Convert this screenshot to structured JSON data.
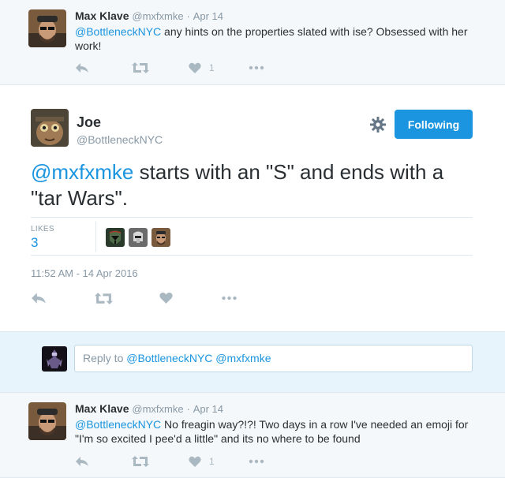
{
  "tweets": {
    "top": {
      "author_name": "Max Klave",
      "handle": "@mxfxmke",
      "separator": "·",
      "date": "Apr 14",
      "mention": "@BottleneckNYC",
      "text": " any hints on the properties slated with ise? Obsessed with her work!",
      "like_count": "1"
    },
    "main": {
      "author_name": "Joe",
      "handle": "@BottleneckNYC",
      "follow_label": "Following",
      "mention": "@mxfxmke",
      "text": " starts with an \"S\" and ends with a \"tar Wars\".",
      "likes_label": "LIKES",
      "likes_count": "3",
      "timestamp": "11:52 AM - 14 Apr 2016"
    },
    "reply": {
      "prefix": "Reply to ",
      "mentions": "@BottleneckNYC @mxfxmke"
    },
    "bottom": {
      "author_name": "Max Klave",
      "handle": "@mxfxmke",
      "separator": "·",
      "date": "Apr 14",
      "mention": "@BottleneckNYC",
      "text": " No freagin way?!?! Two days in a row I've needed an emoji for \"I'm so excited I pee'd a little\" and its no where to be found",
      "like_count": "1"
    }
  },
  "colors": {
    "accent": "#1b95e0",
    "muted": "#8899a6",
    "action_icon": "#aab8c2",
    "background_alt": "#f5f8fa"
  },
  "icons": [
    "reply-icon",
    "retweet-icon",
    "heart-icon",
    "more-icon",
    "gear-icon"
  ]
}
